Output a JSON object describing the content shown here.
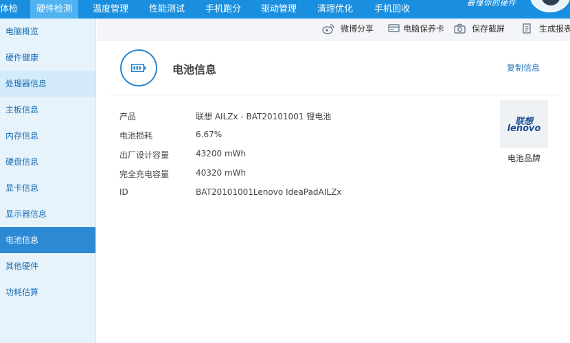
{
  "nav": {
    "tabs": [
      {
        "label": "体检"
      },
      {
        "label": "硬件检测"
      },
      {
        "label": "温度管理"
      },
      {
        "label": "性能测试"
      },
      {
        "label": "手机跑分"
      },
      {
        "label": "驱动管理"
      },
      {
        "label": "清理优化"
      },
      {
        "label": "手机回收"
      }
    ],
    "active": "硬件检测",
    "slogan": "最懂你的硬件"
  },
  "sidebar": {
    "items": [
      {
        "label": "电脑概览"
      },
      {
        "label": "硬件健康"
      },
      {
        "label": "处理器信息"
      },
      {
        "label": "主板信息"
      },
      {
        "label": "内存信息"
      },
      {
        "label": "硬盘信息"
      },
      {
        "label": "显卡信息"
      },
      {
        "label": "显示器信息"
      },
      {
        "label": "电池信息"
      },
      {
        "label": "其他硬件"
      },
      {
        "label": "功耗估算"
      }
    ],
    "active": "电池信息"
  },
  "toolbar": {
    "weibo_share": "微博分享",
    "warranty_card": "电脑保养卡",
    "save_screenshot": "保存截屏",
    "generate_report": "生成报表"
  },
  "main": {
    "title": "电池信息",
    "copy_label": "复制信息",
    "rows": [
      {
        "label": "产品",
        "value": "联想 AILZx - BAT20101001 锂电池"
      },
      {
        "label": "电池损耗",
        "value": "6.67%"
      },
      {
        "label": "出厂设计容量",
        "value": "43200 mWh"
      },
      {
        "label": "完全充电容量",
        "value": "40320 mWh"
      },
      {
        "label": "ID",
        "value": "BAT20101001Lenovo IdeaPadAILZx"
      }
    ],
    "brand": {
      "logo_cn": "联想",
      "logo_en": "lenovo",
      "caption": "电池品牌"
    }
  },
  "colors": {
    "nav_bg": "#1a8fdf",
    "nav_active": "#4fb2f1",
    "sidebar_bg": "#e6f3fb",
    "sidebar_active": "#2c8ad5",
    "link": "#1b6fb5"
  }
}
